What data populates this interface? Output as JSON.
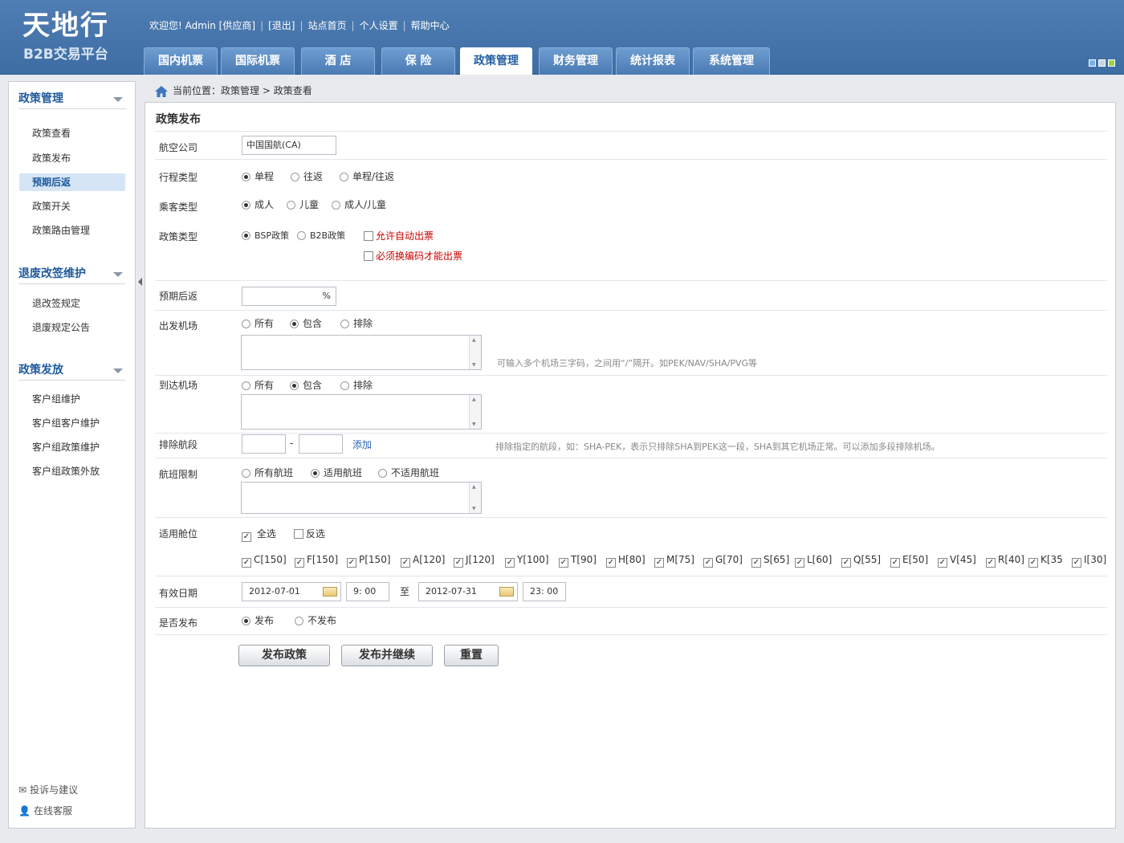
{
  "header": {
    "logo_main": "天地行",
    "logo_sub": "B2B交易平台",
    "nav": {
      "welcome": "欢迎您! Admin [供应商]",
      "logout": "[退出]",
      "home": "站点首页",
      "settings": "个人设置",
      "help": "帮助中心"
    },
    "tabs": [
      "国内机票",
      "国际机票",
      "酒 店",
      "保 险",
      "政策管理",
      "财务管理",
      "统计报表",
      "系统管理"
    ],
    "active_tab": "政策管理",
    "accent_color": "#3e6da3"
  },
  "sidebar": {
    "sections": [
      {
        "title": "政策管理",
        "items": [
          "政策查看",
          "政策发布",
          "预期后返",
          "政策开关",
          "政策路由管理"
        ]
      },
      {
        "title": "退废改签维护",
        "items": [
          "退改签规定",
          "退废规定公告"
        ]
      },
      {
        "title": "政策发放",
        "items": [
          "客户组维护",
          "客户组客户维护",
          "客户组政策维护",
          "客户组政策外放"
        ]
      }
    ],
    "active_item": "预期后返",
    "footer": {
      "feedback": "投诉与建议",
      "service": "在线客服"
    }
  },
  "breadcrumb": {
    "prefix": "当前位置：",
    "path1": "政策管理",
    "sep": ">",
    "path2": "政策查看"
  },
  "form": {
    "title": "政策发布",
    "airline": {
      "label": "航空公司",
      "value": "中国国航(CA)"
    },
    "trip_type": {
      "label": "行程类型",
      "options": [
        "单程",
        "往返",
        "单程/往返"
      ],
      "selected": "单程"
    },
    "passenger_type": {
      "label": "乘客类型",
      "options": [
        "成人",
        "儿童",
        "成人/儿童"
      ],
      "selected": "成人"
    },
    "policy_type": {
      "label": "政策类型",
      "options": [
        "BSP政策",
        "B2B政策"
      ],
      "selected": "BSP政策",
      "auto_issue": "允许自动出票",
      "must_change_pnr": "必须换编码才能出票"
    },
    "expected_rebate": {
      "label": "预期后返",
      "value": "",
      "unit": "%"
    },
    "departure": {
      "label": "出发机场",
      "options": [
        "所有",
        "包含",
        "排除"
      ],
      "selected": "包含",
      "hint": "可输入多个机场三字码，之间用“/”隔开。如PEK/NAV/SHA/PVG等"
    },
    "arrival": {
      "label": "到达机场",
      "options": [
        "所有",
        "包含",
        "排除"
      ],
      "selected": "包含"
    },
    "exclude_segment": {
      "label": "排除航段",
      "dash": "-",
      "add": "添加",
      "hint": "排除指定的航段，如：SHA-PEK，表示只排除SHA到PEK这一段，SHA到其它机场正常。可以添加多段排除机场。"
    },
    "flight_limit": {
      "label": "航班限制",
      "options": [
        "所有航班",
        "适用航班",
        "不适用航班"
      ],
      "selected": "适用航班"
    },
    "cabins": {
      "label": "适用舱位",
      "select_all": "全选",
      "invert": "反选",
      "items": [
        "C[150]",
        "F[150]",
        "P[150]",
        "A[120]",
        "J[120]",
        "Y[100]",
        "T[90]",
        "H[80]",
        "M[75]",
        "G[70]",
        "S[65]",
        "L[60]",
        "Q[55]",
        "E[50]",
        "V[45]",
        "R[40]",
        "K[35",
        "I[30]"
      ]
    },
    "valid_date": {
      "label": "有效日期",
      "start_date": "2012-07-01",
      "start_time": "9: 00",
      "to": "至",
      "end_date": "2012-07-31",
      "end_time": "23: 00"
    },
    "publish": {
      "label": "是否发布",
      "options": [
        "发布",
        "不发布"
      ],
      "selected": "发布"
    },
    "buttons": {
      "publish": "发布政策",
      "publish_continue": "发布并继续",
      "reset": "重置"
    }
  }
}
